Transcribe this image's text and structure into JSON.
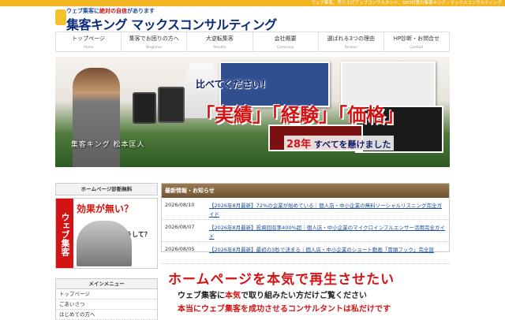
{
  "topbar": {
    "text": "ウェブ集客、売り上げアップコンサルタント、SEO対策の集客キング・マックスコンサルティング"
  },
  "logo": {
    "tagline_pre": "ウェブ集客に",
    "tagline_em": "絶対の自信",
    "tagline_post": "があります",
    "name": "集客キング マックスコンサルティング"
  },
  "nav": [
    {
      "jp": "トップページ",
      "en": "Home"
    },
    {
      "jp": "集客でお困りの方へ",
      "en": "Beginner"
    },
    {
      "jp": "大逆転集客",
      "en": "Results"
    },
    {
      "jp": "会社概要",
      "en": "Company"
    },
    {
      "jp": "選ばれる3つの理由",
      "en": "Reason"
    },
    {
      "jp": "HP診断・お問合せ",
      "en": "Contact"
    }
  ],
  "hero": {
    "caption": "集客キング 松本匡人",
    "headline1": "比べてください！",
    "headline2": "「実績」「経験」「価格」",
    "headline3_num": "28年",
    "headline3_rest": " すべてを懸けました"
  },
  "sidebar": {
    "diag_header": "ホームページ診断無料",
    "diag_text1": "効果が無い？",
    "diag_text2": "どうして？",
    "diag_vertical": "ウェブ集客",
    "menu_header": "メインメニュー",
    "menu_items": [
      "トップページ",
      "ごあいさつ",
      "はじめての方へ"
    ]
  },
  "news": {
    "header": "最新情報・お知らせ",
    "items": [
      {
        "date": "2026/08/10",
        "title": "【2026年8月最新】72%の企業が始めている｜個人店・中小企業の無料ソーシャルリスニング完全ガイド"
      },
      {
        "date": "2026/08/07",
        "title": "【2026年8月最新】投資回収率400%超｜個人店・中小企業のマイクロインフルエンサー活用完全ガイド"
      },
      {
        "date": "2026/08/05",
        "title": "【2026年8月最新】最初の3秒で決まる｜個人店・中小企業のショート動画「冒頭フック」完全設"
      }
    ]
  },
  "main": {
    "message1": "ホームページを本気で再生させたい",
    "message2_pre": "ウェブ集客に",
    "message2_em": "本気",
    "message2_post": "で取り組みたい方だけご覧ください",
    "message3": "本当にウェブ集客を成功させるコンサルタントは私だけです"
  },
  "colors": {
    "accent": "#f1b622",
    "red": "#d41414",
    "navy": "#0d1f66",
    "news_header": "#6f5232"
  }
}
